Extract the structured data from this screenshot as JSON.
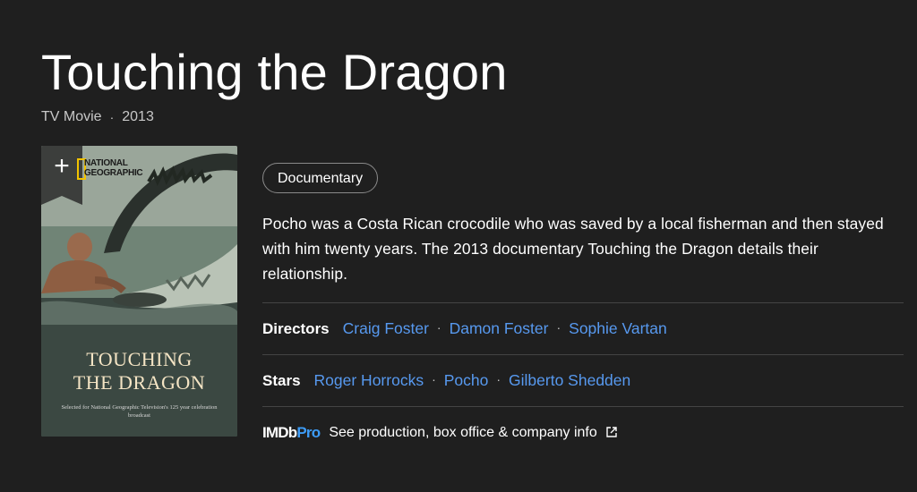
{
  "title": "Touching the Dragon",
  "meta": {
    "type": "TV Movie",
    "separator": "·",
    "year": "2013"
  },
  "poster": {
    "brand": "NATIONAL\nGEOGRAPHIC",
    "title_line1": "TOUCHING",
    "title_line2": "THE DRAGON",
    "subtitle": "Selected for National Geographic Television's 125 year celebration broadcast",
    "add_icon": "plus-icon"
  },
  "genres": [
    "Documentary"
  ],
  "plot": "Pocho was a Costa Rican crocodile who was saved by a local fisherman and then stayed with him twenty years. The 2013 documentary Touching the Dragon details their relationship.",
  "directors": {
    "label": "Directors",
    "names": [
      "Craig Foster",
      "Damon Foster",
      "Sophie Vartan"
    ]
  },
  "stars": {
    "label": "Stars",
    "names": [
      "Roger Horrocks",
      "Pocho",
      "Gilberto Shedden"
    ]
  },
  "imdbpro": {
    "logo_imdb": "IMDb",
    "logo_pro": "Pro",
    "link": "See production, box office & company info",
    "icon": "external-link-icon"
  },
  "colors": {
    "background": "#1f1f1f",
    "link": "#5799ef",
    "pro_blue": "#3d9cf7"
  }
}
